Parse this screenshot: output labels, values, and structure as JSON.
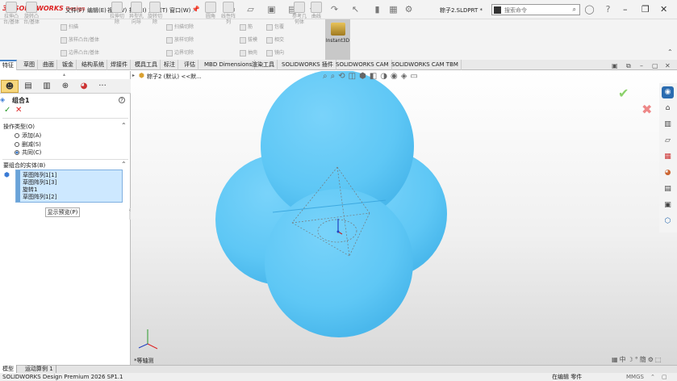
{
  "app": {
    "logo_ds": "3S",
    "logo_text": "SOLIDWORKS",
    "logo_sub": "Design",
    "doc_title": "粽子2.SLDPRT *"
  },
  "menu": [
    "文件(F)",
    "编辑(E)",
    "视图(V)",
    "插入(I)",
    "工具(T)",
    "窗口(W)"
  ],
  "search": {
    "placeholder": "搜索命令"
  },
  "ribbon": {
    "buttons": [
      {
        "label": "拉伸凸台/基体",
        "active": false
      },
      {
        "label": "旋转凸台/基体",
        "active": false
      },
      {
        "label": "拉伸切除",
        "active": false
      },
      {
        "label": "异型孔向导",
        "active": false
      },
      {
        "label": "旋转切除",
        "active": false
      },
      {
        "label": "圆角",
        "active": false
      },
      {
        "label": "线性阵列",
        "active": false
      },
      {
        "label": "参考几何体",
        "active": false
      },
      {
        "label": "曲线",
        "active": false
      }
    ],
    "small": [
      "扫描",
      "放样凸台/基体",
      "边界凸台/基体",
      "扫描切除",
      "放样切除",
      "边界切除",
      "筋",
      "拔模",
      "抽壳",
      "包覆",
      "相交",
      "镜向"
    ],
    "instant3d": "Instant3D"
  },
  "tabs": [
    "特征",
    "草图",
    "曲面",
    "钣金",
    "结构系统",
    "焊接件",
    "模具工具",
    "标注",
    "评估",
    "MBD Dimensions",
    "渲染工具",
    "SOLIDWORKS 插件",
    "SOLIDWORKS CAM",
    "SOLIDWORKS CAM TBM"
  ],
  "active_tab": "特征",
  "panel": {
    "feature_name": "组合1",
    "help": "?",
    "ok": "✓",
    "cancel": "✕",
    "op_section": "操作类型(O)",
    "options": [
      {
        "label": "添加(A)",
        "selected": false
      },
      {
        "label": "删减(S)",
        "selected": false
      },
      {
        "label": "共同(C)",
        "selected": true
      }
    ],
    "bodies_section": "要组合的实体(B)",
    "bodies": [
      "草图阵列1[1]",
      "草图阵列1[3]",
      "旋转1",
      "草图阵列1[2]"
    ],
    "show_preview": "显示预览(P)"
  },
  "viewport": {
    "breadcrumb": "粽子2 (默认) <<默...",
    "view_label": "*等轴测",
    "body_color": "#5ec7f5"
  },
  "bottom_tabs": [
    "模型",
    "运动算例 1"
  ],
  "status": {
    "left": "SOLIDWORKS Design Premium 2026 SP1.1",
    "mode": "在编辑 零件",
    "units": "MMGS"
  }
}
